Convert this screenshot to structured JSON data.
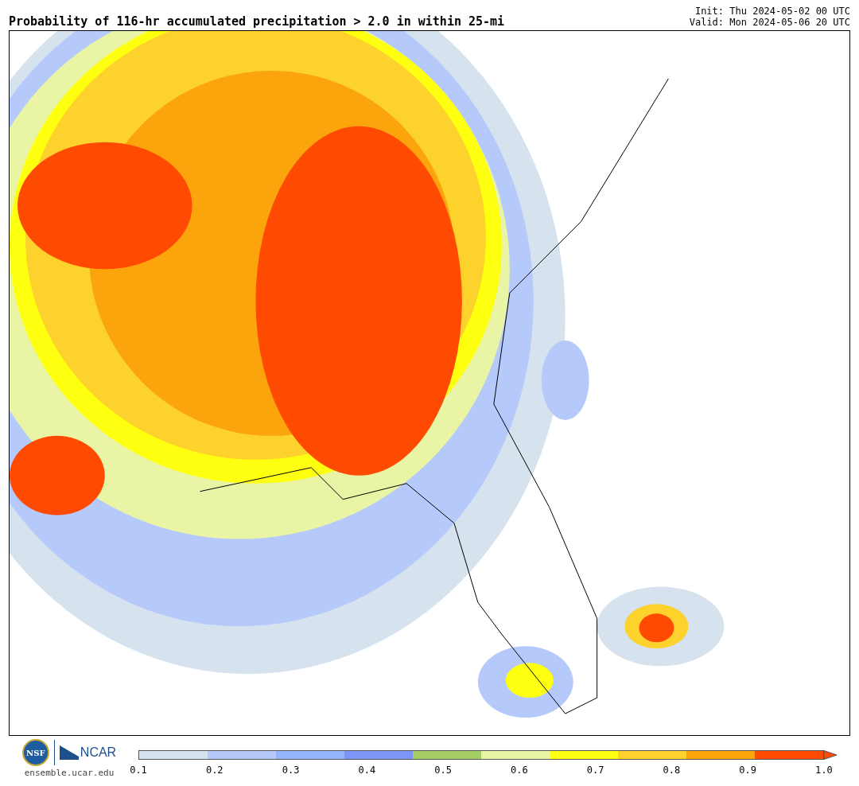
{
  "title": "Probability of 116-hr accumulated precipitation > 2.0 in within 25-mi",
  "init": "Init: Thu 2024-05-02 00 UTC",
  "valid": "Valid: Mon 2024-05-06 20 UTC",
  "logos": {
    "nsf": "NSF",
    "ncar": "NCAR",
    "site": "ensemble.ucar.edu"
  },
  "colorbar": {
    "segments": [
      {
        "color": "#d6e2ed"
      },
      {
        "color": "#b5c9fb"
      },
      {
        "color": "#93b3fa"
      },
      {
        "color": "#7b96f5"
      },
      {
        "color": "#a5cd65"
      },
      {
        "color": "#e9f5a5"
      },
      {
        "color": "#ffff10"
      },
      {
        "color": "#fdd22c"
      },
      {
        "color": "#fba40c"
      },
      {
        "color": "#ff4a02"
      }
    ],
    "ticks": [
      "0.1",
      "0.2",
      "0.3",
      "0.4",
      "0.5",
      "0.6",
      "0.7",
      "0.8",
      "0.9",
      "1.0"
    ]
  }
}
